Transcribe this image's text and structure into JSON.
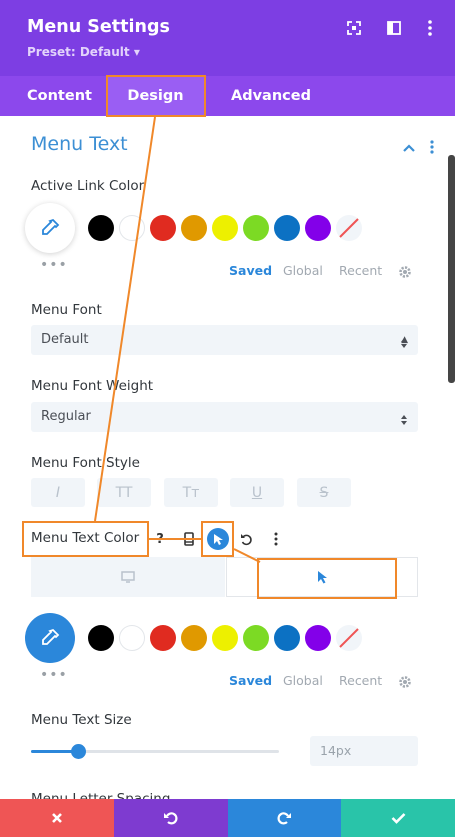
{
  "header": {
    "title": "Menu Settings",
    "preset": "Preset: Default ▾"
  },
  "tabs": [
    {
      "label": "Content"
    },
    {
      "label": "Design",
      "active": true
    },
    {
      "label": "Advanced"
    }
  ],
  "section": {
    "title": "Menu Text",
    "collapse_icon": "chevron-up-icon"
  },
  "active_link_color": {
    "label": "Active Link Color",
    "swatches": [
      "#000000",
      "#ffffff",
      "#e02b20",
      "#e09900",
      "#edf000",
      "#7cda24",
      "#0c71c3",
      "#8300e9"
    ],
    "more": "•••",
    "palette_tabs": [
      "Saved",
      "Global",
      "Recent"
    ]
  },
  "menu_font": {
    "label": "Menu Font",
    "value": "Default"
  },
  "menu_font_weight": {
    "label": "Menu Font Weight",
    "value": "Regular"
  },
  "menu_font_style": {
    "label": "Menu Font Style",
    "buttons": [
      "I",
      "TT",
      "Tт",
      "U",
      "S"
    ]
  },
  "menu_text_color": {
    "label": "Menu Text Color",
    "control_icons": [
      "help-icon",
      "responsive-icon",
      "hover-icon",
      "reset-icon",
      "more-icon"
    ],
    "swatches": [
      "#000000",
      "#ffffff",
      "#e02b20",
      "#e09900",
      "#edf000",
      "#7cda24",
      "#0c71c3",
      "#8300e9"
    ],
    "more": "•••",
    "palette_tabs": [
      "Saved",
      "Global",
      "Recent"
    ]
  },
  "menu_text_size": {
    "label": "Menu Text Size",
    "value": "14px",
    "slider_fraction": 0.19
  },
  "next_label": "Menu Letter Spacing",
  "colors": {
    "purple_header": "#7d3ee3",
    "purple_tabs": "#8c48ec",
    "blue_accent": "#2b87da",
    "orange_annotation": "#f0882a",
    "footer_red": "#ef5555",
    "footer_purple": "#7e3bd0",
    "footer_blue": "#2b87da",
    "footer_green": "#29c4a9"
  },
  "footer": [
    "close-icon",
    "undo-icon",
    "redo-icon",
    "check-icon"
  ]
}
